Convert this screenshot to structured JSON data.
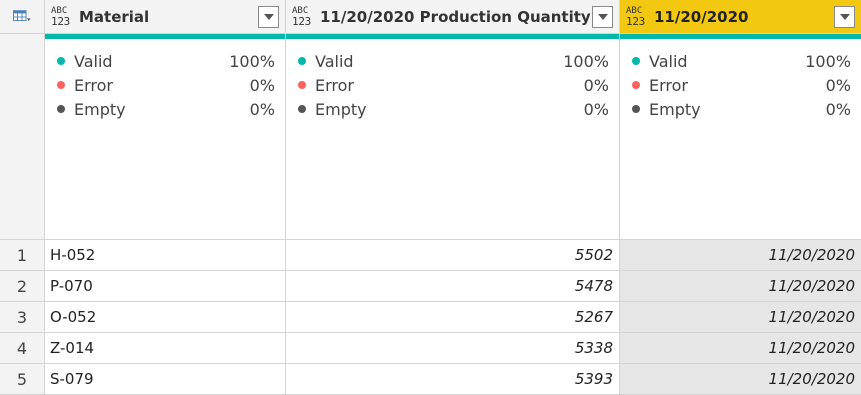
{
  "columns": [
    {
      "type_top": "ABC",
      "type_bottom": "123",
      "title": "Material"
    },
    {
      "type_top": "ABC",
      "type_bottom": "123",
      "title": "11/20/2020 Production Quantity"
    },
    {
      "type_top": "ABC",
      "type_bottom": "123",
      "title": "11/20/2020"
    }
  ],
  "quality": [
    {
      "valid_label": "Valid",
      "valid": "100%",
      "error_label": "Error",
      "error": "0%",
      "empty_label": "Empty",
      "empty": "0%"
    },
    {
      "valid_label": "Valid",
      "valid": "100%",
      "error_label": "Error",
      "error": "0%",
      "empty_label": "Empty",
      "empty": "0%"
    },
    {
      "valid_label": "Valid",
      "valid": "100%",
      "error_label": "Error",
      "error": "0%",
      "empty_label": "Empty",
      "empty": "0%"
    }
  ],
  "colors": {
    "valid": "#01b8aa",
    "error": "#fd625e",
    "empty": "#555555",
    "selected_header": "#f2c811"
  },
  "rows": [
    {
      "num": "1",
      "material": "H-052",
      "qty": "5502",
      "date": "11/20/2020"
    },
    {
      "num": "2",
      "material": "P-070",
      "qty": "5478",
      "date": "11/20/2020"
    },
    {
      "num": "3",
      "material": "O-052",
      "qty": "5267",
      "date": "11/20/2020"
    },
    {
      "num": "4",
      "material": "Z-014",
      "qty": "5338",
      "date": "11/20/2020"
    },
    {
      "num": "5",
      "material": "S-079",
      "qty": "5393",
      "date": "11/20/2020"
    }
  ]
}
